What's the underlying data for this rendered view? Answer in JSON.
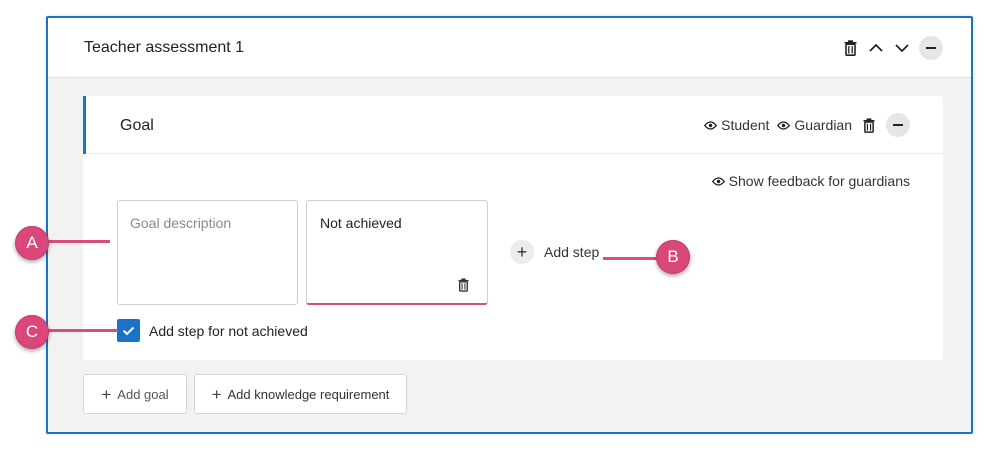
{
  "assessment": {
    "title": "Teacher assessment 1"
  },
  "goal": {
    "title": "Goal",
    "visibility": {
      "student_label": "Student",
      "guardian_label": "Guardian"
    },
    "show_feedback_label": "Show feedback for guardians",
    "description_placeholder": "Goal description",
    "description_value": "",
    "step_value": "Not achieved",
    "add_step_label": "Add step",
    "checkbox": {
      "label": "Add step for not achieved",
      "checked": true
    }
  },
  "actions": {
    "add_goal_label": "Add goal",
    "add_knowledge_label": "Add knowledge requirement"
  },
  "callouts": {
    "a": "A",
    "b": "B",
    "c": "C"
  },
  "icons": [
    "trash-icon",
    "chevron-up-icon",
    "chevron-down-icon",
    "minus-icon",
    "eye-icon",
    "plus-icon",
    "check-icon"
  ],
  "colors": {
    "accent": "#1a73c8",
    "callout": "#d9477b",
    "error_underline": "#d9506e"
  }
}
